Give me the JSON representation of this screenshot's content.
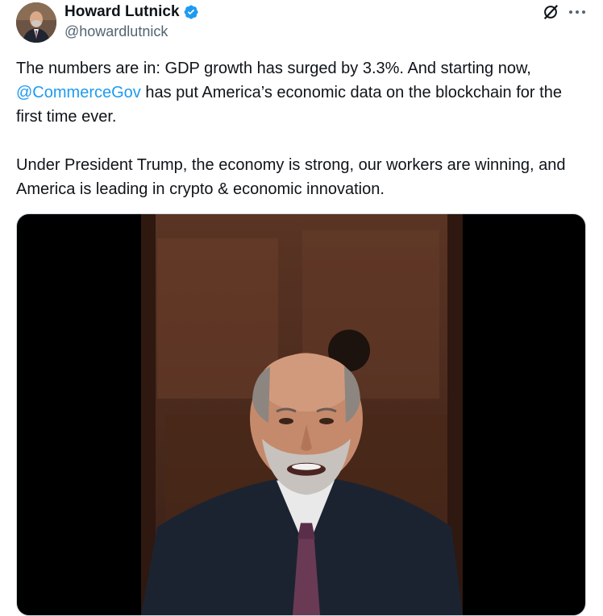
{
  "author": {
    "display_name": "Howard Lutnick",
    "handle": "@howardlutnick",
    "avatar_icon": "person-avatar",
    "verified_icon": "verified-badge-icon",
    "verified_color": "#1d9bf0"
  },
  "header_actions": {
    "grok_icon": "grok-icon",
    "more_icon": "more-options-icon"
  },
  "tweet": {
    "text_part1": "The numbers are in: GDP growth has surged by 3.3%. And starting now, ",
    "mention": "@CommerceGov",
    "text_part2": " has put America’s economic data on the blockchain for the first time ever.\n\nUnder President Trump, the economy is strong, our workers are winning, and America is leading in crypto & economic innovation.",
    "mention_color": "#1d9bf0"
  },
  "media": {
    "type": "video",
    "subject_icon": "video-still-speaker"
  }
}
